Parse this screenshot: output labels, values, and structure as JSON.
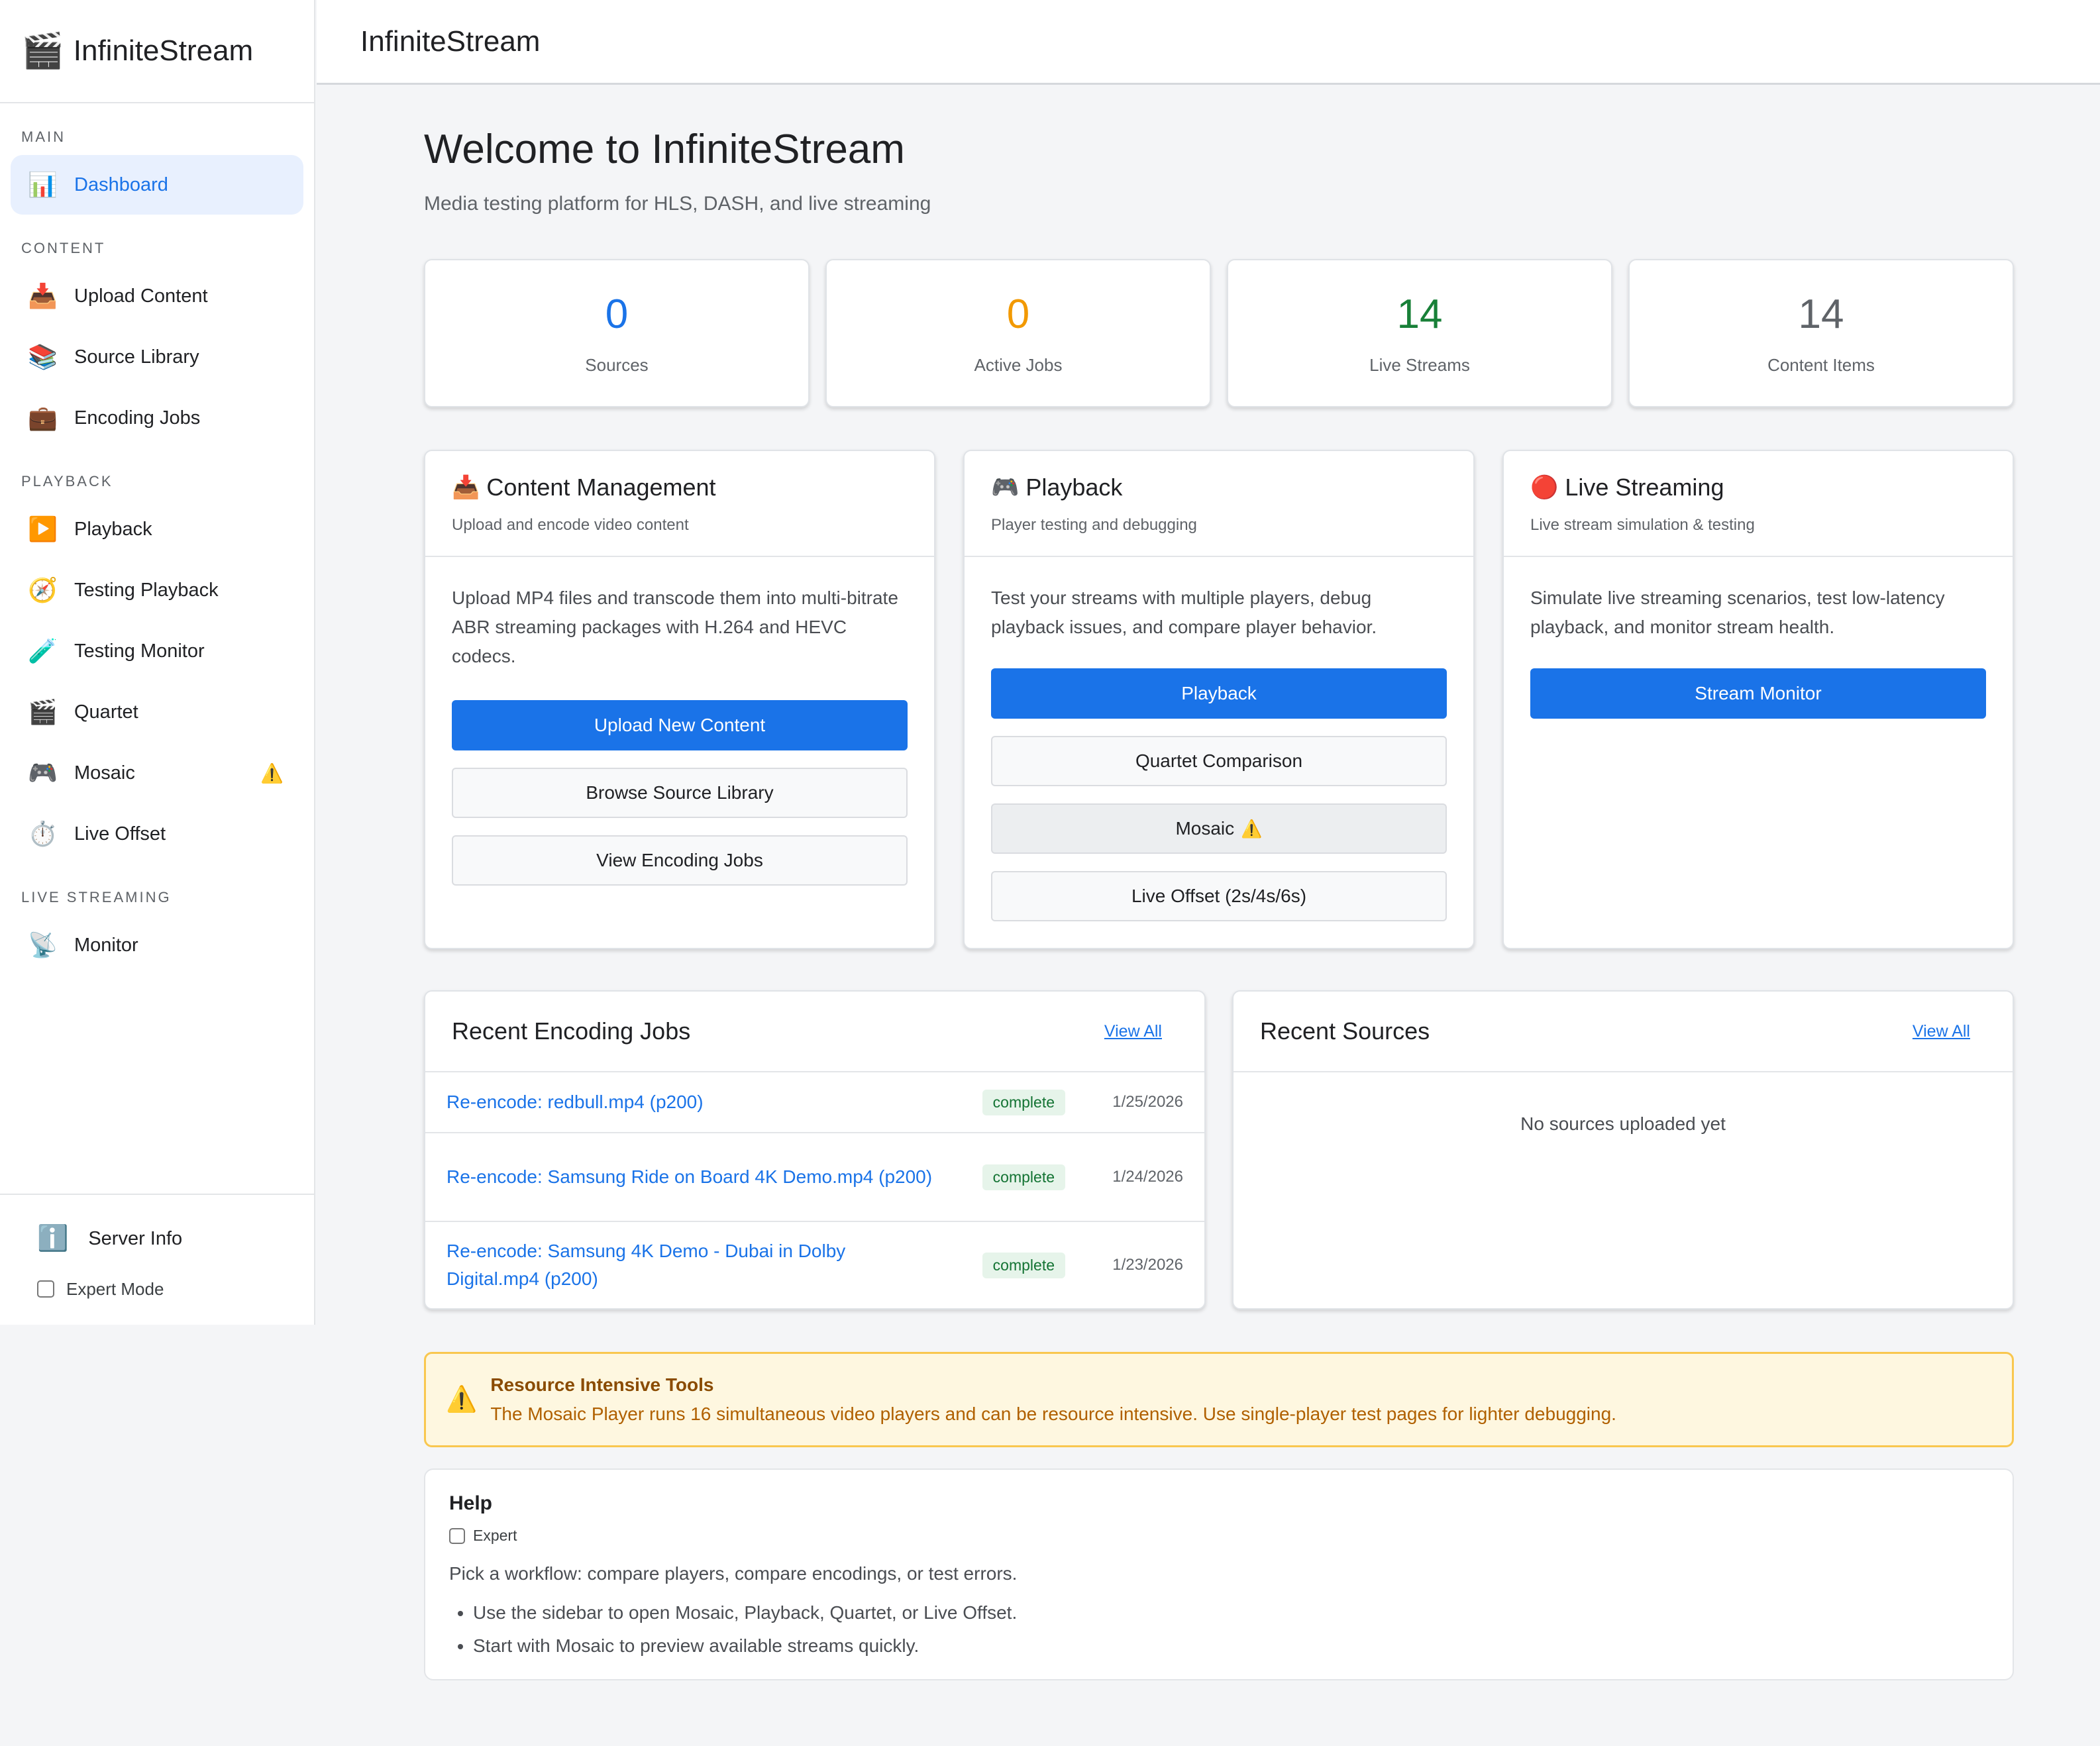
{
  "app": {
    "logo": "🎬",
    "title": "InfiniteStream"
  },
  "header": {
    "title": "InfiniteStream"
  },
  "sidebar": {
    "sections": {
      "main": "MAIN",
      "content": "CONTENT",
      "playback": "PLAYBACK",
      "live": "LIVE STREAMING"
    },
    "items": [
      {
        "icon": "📊",
        "label": "Dashboard"
      },
      {
        "icon": "📥",
        "label": "Upload Content"
      },
      {
        "icon": "📚",
        "label": "Source Library"
      },
      {
        "icon": "💼",
        "label": "Encoding Jobs"
      },
      {
        "icon": "▶️",
        "label": "Playback"
      },
      {
        "icon": "🧭",
        "label": "Testing Playback"
      },
      {
        "icon": "🧪",
        "label": "Testing Monitor"
      },
      {
        "icon": "🎬",
        "label": "Quartet"
      },
      {
        "icon": "🎮",
        "label": "Mosaic",
        "badge": "⚠️"
      },
      {
        "icon": "⏱️",
        "label": "Live Offset"
      },
      {
        "icon": "📡",
        "label": "Monitor"
      }
    ],
    "footer": {
      "server_icon": "ℹ️",
      "server_label": "Server Info",
      "expert_label": "Expert Mode"
    }
  },
  "page": {
    "title": "Welcome to InfiniteStream",
    "subtitle": "Media testing platform for HLS, DASH, and live streaming"
  },
  "stats": [
    {
      "value": "0",
      "label": "Sources",
      "color": "#1a73e8"
    },
    {
      "value": "0",
      "label": "Active Jobs",
      "color": "#f29900"
    },
    {
      "value": "14",
      "label": "Live Streams",
      "color": "#188038"
    },
    {
      "value": "14",
      "label": "Content Items",
      "color": "#5f6368"
    }
  ],
  "cards": {
    "content": {
      "icon": "📥",
      "title": "Content Management",
      "subtitle": "Upload and encode video content",
      "description": "Upload MP4 files and transcode them into multi-bitrate ABR streaming packages with H.264 and HEVC codecs.",
      "buttons": [
        "Upload New Content",
        "Browse Source Library",
        "View Encoding Jobs"
      ]
    },
    "playback": {
      "icon": "🎮",
      "title": "Playback",
      "subtitle": "Player testing and debugging",
      "description": "Test your streams with multiple players, debug playback issues, and compare player behavior.",
      "buttons": [
        "Playback",
        "Quartet Comparison",
        "Mosaic",
        "Live Offset (2s/4s/6s)"
      ],
      "mosaic_warn": "⚠️"
    },
    "live": {
      "icon": "🔴",
      "title": "Live Streaming",
      "subtitle": "Live stream simulation & testing",
      "description": "Simulate live streaming scenarios, test low-latency playback, and monitor stream health.",
      "buttons": [
        "Stream Monitor"
      ]
    }
  },
  "recent_jobs": {
    "title": "Recent Encoding Jobs",
    "view_all": "View All",
    "rows": [
      {
        "name": "Re-encode: redbull.mp4 (p200)",
        "status": "complete",
        "date": "1/25/2026"
      },
      {
        "name": "Re-encode: Samsung Ride on Board 4K Demo.mp4 (p200)",
        "status": "complete",
        "date": "1/24/2026"
      },
      {
        "name": "Re-encode: Samsung 4K Demo - Dubai in Dolby Digital.mp4 (p200)",
        "status": "complete",
        "date": "1/23/2026"
      }
    ]
  },
  "recent_sources": {
    "title": "Recent Sources",
    "view_all": "View All",
    "empty": "No sources uploaded yet"
  },
  "alert": {
    "icon": "⚠️",
    "title": "Resource Intensive Tools",
    "text": "The Mosaic Player runs 16 simultaneous video players and can be resource intensive. Use single-player test pages for lighter debugging."
  },
  "help": {
    "title": "Help",
    "expert_label": "Expert",
    "text": "Pick a workflow: compare players, compare encodings, or test errors.",
    "bullets": [
      "Use the sidebar to open Mosaic, Playback, Quartet, or Live Offset.",
      "Start with Mosaic to preview available streams quickly."
    ]
  }
}
